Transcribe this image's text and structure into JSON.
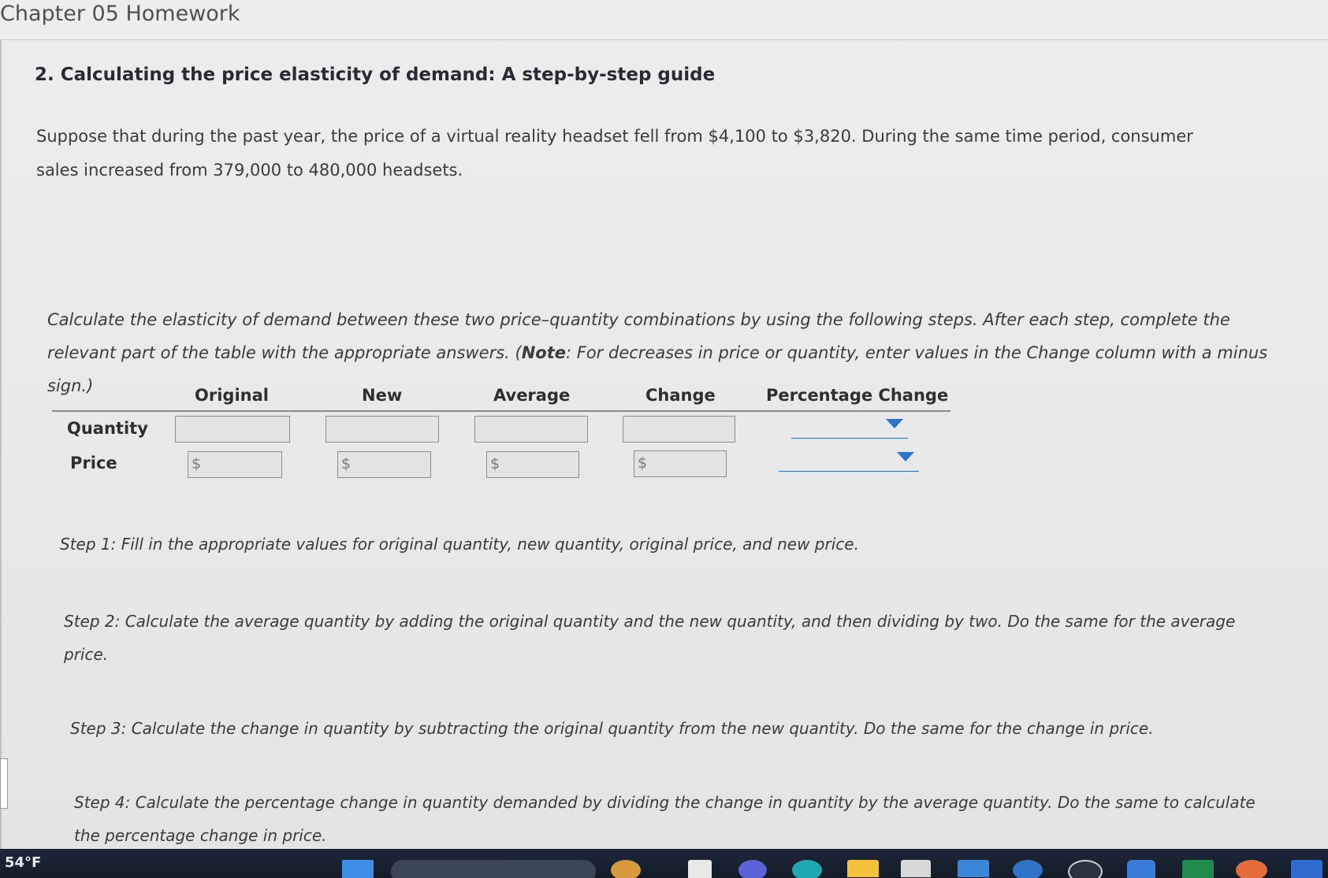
{
  "app": {
    "title": "Chapter 05 Homework"
  },
  "question": {
    "title": "2. Calculating the price elasticity of demand: A step-by-step guide",
    "intro": "Suppose that during the past year, the price of a virtual reality headset fell from $4,100 to $3,820. During the same time period, consumer sales increased from 379,000 to 480,000 headsets.",
    "instructions_pre": "Calculate the elasticity of demand between these two price–quantity combinations by using the following steps. After each step, complete the relevant part of the table with the appropriate answers. (",
    "instructions_note": "Note",
    "instructions_post": ": For decreases in price or quantity, enter values in the Change column with a minus sign.)"
  },
  "table": {
    "columns": [
      "Original",
      "New",
      "Average",
      "Change",
      "Percentage Change"
    ],
    "rows": [
      {
        "label": "Quantity",
        "values": [
          "",
          "",
          "",
          ""
        ],
        "percentage_change": ""
      },
      {
        "label": "Price",
        "currency_symbol": "$",
        "values": [
          "",
          "",
          "",
          ""
        ],
        "percentage_change": ""
      }
    ]
  },
  "steps": [
    "Step 1: Fill in the appropriate values for original quantity, new quantity, original price, and new price.",
    "Step 2: Calculate the average quantity by adding the original quantity and the new quantity, and then dividing by two. Do the same for the average price.",
    "Step 3: Calculate the change in quantity by subtracting the original quantity from the new quantity. Do the same for the change in price.",
    "Step 4: Calculate the percentage change in quantity demanded by dividing the change in quantity by the average quantity. Do the same to calculate the percentage change in price."
  ],
  "taskbar": {
    "temperature": "54°F"
  }
}
